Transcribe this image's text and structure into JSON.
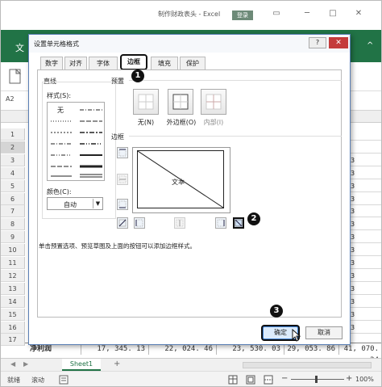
{
  "window": {
    "title": "制作财政表头 - Excel",
    "login": "登录",
    "help_icon": "?",
    "restore_icon": "▭",
    "min_icon": "─",
    "max_icon": "□",
    "close_icon": "✕"
  },
  "ribbon": {
    "file_tab": "文",
    "right_char": "^"
  },
  "namebox": "A2",
  "rows": [
    "1",
    "2",
    "3",
    "4",
    "5",
    "6",
    "7",
    "8",
    "9",
    "10",
    "11",
    "12",
    "13",
    "14",
    "15",
    "16",
    "17"
  ],
  "right_col": [
    "",
    "",
    "3",
    "3",
    "3",
    "3",
    "3",
    "3",
    "3",
    "3",
    "3",
    "3",
    "3",
    "3",
    "3",
    "3"
  ],
  "row17": [
    "净利润",
    "17, 345. 13",
    "22, 024. 46",
    "23, 530. 03",
    "29, 053. 86",
    "41, 070. 24"
  ],
  "sheet": {
    "tab": "Sheet1",
    "add": "+"
  },
  "status": {
    "ready": "就绪",
    "scroll": "滚动",
    "zoom": "100%"
  },
  "dialog": {
    "title": "设置单元格格式",
    "help": "?",
    "close": "✕",
    "tabs": [
      "数字",
      "对齐",
      "字体",
      "边框",
      "填充",
      "保护"
    ],
    "line_section": "直线",
    "style_label": "样式(S):",
    "style_none": "无",
    "color_label": "颜色(C):",
    "color_value": "自动",
    "preset_section": "预置",
    "presets": [
      "无(N)",
      "外边框(O)",
      "内部(I)"
    ],
    "border_section": "边框",
    "preview_text": "文本",
    "hint": "单击预置选项、预览草图及上面的按钮可以添加边框样式。",
    "ok": "确定",
    "cancel": "取消"
  },
  "markers": [
    "1",
    "2",
    "3"
  ]
}
